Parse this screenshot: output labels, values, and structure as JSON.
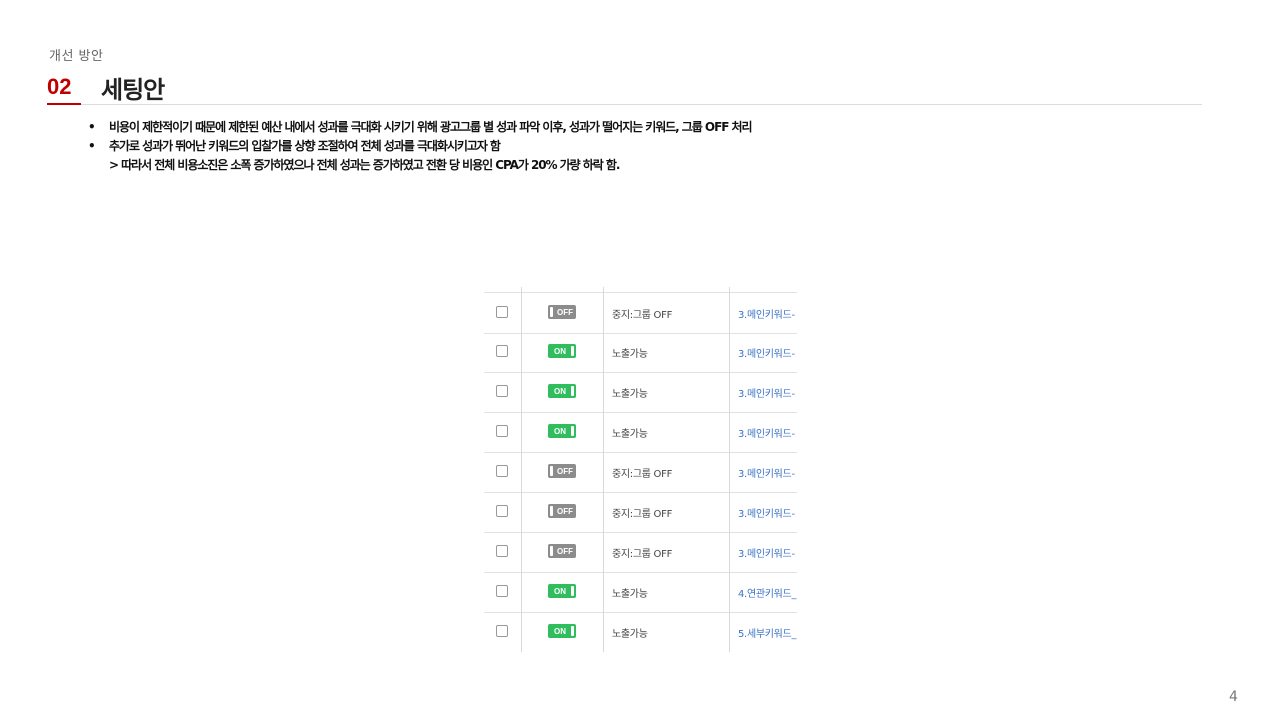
{
  "header": {
    "kicker": "개선 방안",
    "section_number": "02",
    "section_title": "세팅안"
  },
  "bullets": [
    "비용이 제한적이기 때문에 제한된 예산 내에서 성과를 극대화 시키기 위해 광고그룹 별 성과 파악 이후, 성과가 떨어지는 키워드, 그룹 OFF 처리",
    "추가로 성과가 뛰어난 키워드의 입찰가를 상향 조절하여 전체 성과를 극대화시키고자 함"
  ],
  "bullet_sub": "> 따라서 전체 비용소진은 소폭 증가하였으나 전체 성과는 증가하였고 전환 당 비용인 CPA가 20% 가량 하락 함.",
  "bullet_glyph": "•",
  "table": {
    "on_label": "ON",
    "off_label": "OFF",
    "rows": [
      {
        "state": "off",
        "status": "중지:그룹 OFF",
        "keyword": "3.메인키워드-"
      },
      {
        "state": "on",
        "status": "노출가능",
        "keyword": "3.메인키워드-"
      },
      {
        "state": "on",
        "status": "노출가능",
        "keyword": "3.메인키워드-"
      },
      {
        "state": "on",
        "status": "노출가능",
        "keyword": "3.메인키워드-"
      },
      {
        "state": "off",
        "status": "중지:그룹 OFF",
        "keyword": "3.메인키워드-"
      },
      {
        "state": "off",
        "status": "중지:그룹 OFF",
        "keyword": "3.메인키워드-"
      },
      {
        "state": "off",
        "status": "중지:그룹 OFF",
        "keyword": "3.메인키워드-"
      },
      {
        "state": "on",
        "status": "노출가능",
        "keyword": "4.연관키워드_"
      },
      {
        "state": "on",
        "status": "노출가능",
        "keyword": "5.세부키워드_"
      }
    ]
  },
  "page_number": "4"
}
